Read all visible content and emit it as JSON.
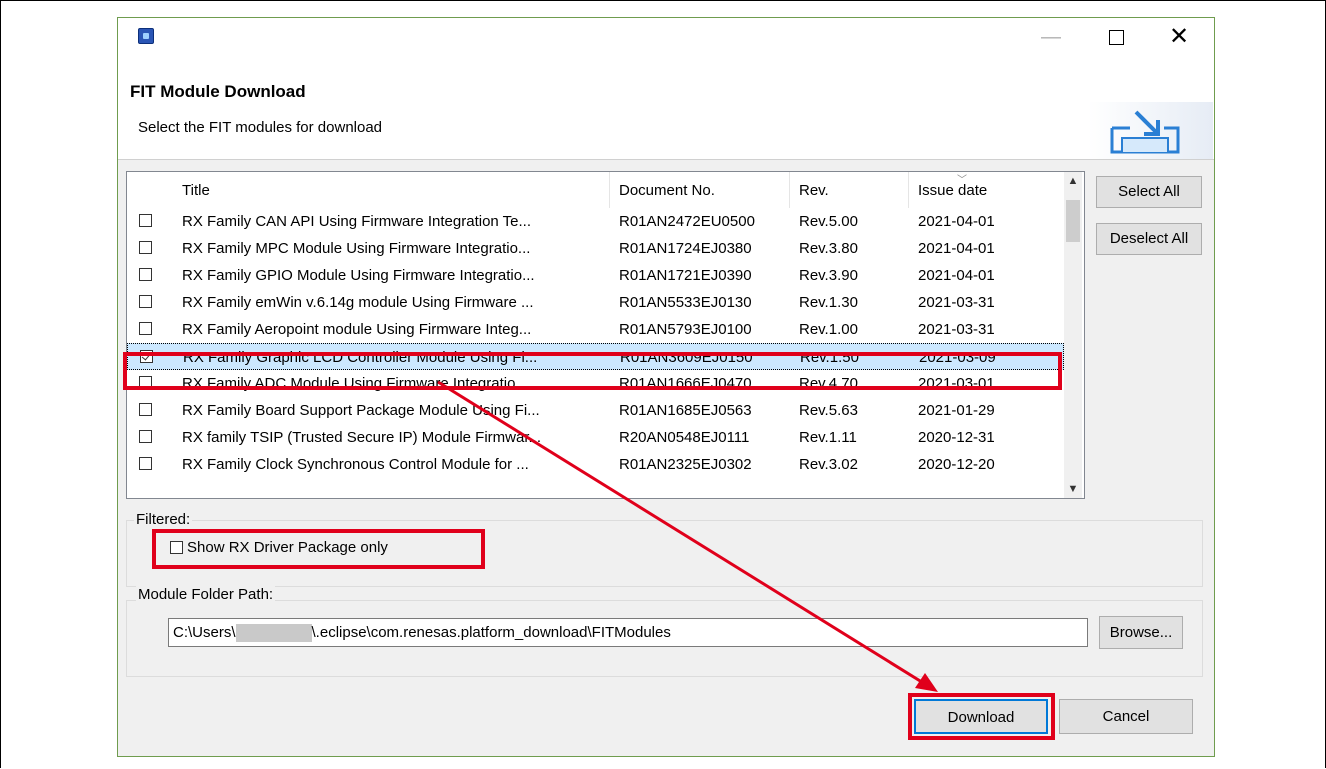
{
  "window": {
    "min_symbol": "—",
    "close_symbol": "✕"
  },
  "header": {
    "title": "FIT Module Download",
    "subtitle": "Select the FIT modules for download"
  },
  "table": {
    "columns": [
      "Title",
      "Document No.",
      "Rev.",
      "Issue date"
    ],
    "rows": [
      {
        "checked": false,
        "title": "RX Family CAN API Using Firmware Integration Te...",
        "doc": "R01AN2472EU0500",
        "rev": "Rev.5.00",
        "date": "2021-04-01"
      },
      {
        "checked": false,
        "title": "RX Family MPC Module Using Firmware Integratio...",
        "doc": "R01AN1724EJ0380",
        "rev": "Rev.3.80",
        "date": "2021-04-01"
      },
      {
        "checked": false,
        "title": "RX Family GPIO Module Using Firmware Integratio...",
        "doc": "R01AN1721EJ0390",
        "rev": "Rev.3.90",
        "date": "2021-04-01"
      },
      {
        "checked": false,
        "title": "RX Family emWin v.6.14g module Using Firmware ...",
        "doc": "R01AN5533EJ0130",
        "rev": "Rev.1.30",
        "date": "2021-03-31"
      },
      {
        "checked": false,
        "title": "RX Family Aeropoint module Using Firmware Integ...",
        "doc": "R01AN5793EJ0100",
        "rev": "Rev.1.00",
        "date": "2021-03-31"
      },
      {
        "checked": true,
        "title": "RX Family Graphic LCD Controller Module Using Fi...",
        "doc": "R01AN3609EJ0150",
        "rev": "Rev.1.50",
        "date": "2021-03-09"
      },
      {
        "checked": false,
        "title": "RX Family ADC Module Using Firmware Integratio...",
        "doc": "R01AN1666EJ0470",
        "rev": "Rev.4.70",
        "date": "2021-03-01"
      },
      {
        "checked": false,
        "title": "RX Family Board Support Package Module Using Fi...",
        "doc": "R01AN1685EJ0563",
        "rev": "Rev.5.63",
        "date": "2021-01-29"
      },
      {
        "checked": false,
        "title": "RX family TSIP (Trusted Secure IP) Module Firmwar...",
        "doc": "R20AN0548EJ0111",
        "rev": "Rev.1.11",
        "date": "2020-12-31"
      },
      {
        "checked": false,
        "title": "RX Family Clock Synchronous Control Module for ...",
        "doc": "R01AN2325EJ0302",
        "rev": "Rev.3.02",
        "date": "2020-12-20"
      }
    ]
  },
  "buttons": {
    "select_all": "Select All",
    "deselect_all": "Deselect All",
    "browse": "Browse...",
    "download": "Download",
    "cancel": "Cancel"
  },
  "filtered": {
    "label": "Filtered:",
    "show_rx_label": "Show RX Driver Package only",
    "show_rx_checked": false
  },
  "module_path": {
    "label": "Module Folder Path:",
    "prefix": "C:\\Users\\",
    "suffix": "\\.eclipse\\com.renesas.platform_download\\FITModules"
  },
  "colors": {
    "highlight": "#e0001b",
    "selection": "#cce8ff",
    "dialog_border": "#6f9c4e"
  }
}
